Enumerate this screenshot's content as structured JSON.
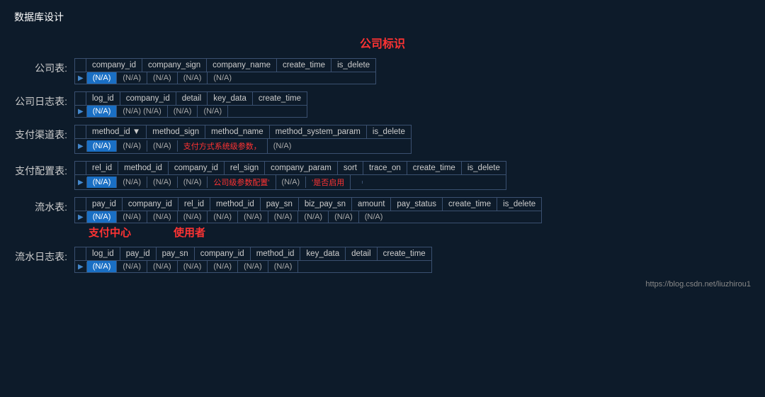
{
  "pageTitle": "数据库设计",
  "centerLabel": "公司标识",
  "footerLink": "https://blog.csdn.net/liuzhirou1",
  "tables": [
    {
      "label": "公司表:",
      "name": "company-table",
      "headers": [
        "company_id",
        "company_sign",
        "company_name",
        "create_time",
        "is_delete"
      ],
      "rows": [
        {
          "cells": [
            "(N/A)",
            "(N/A)",
            "(N/A)",
            "(N/A)",
            "(N/A)"
          ],
          "highlighted": [
            0
          ],
          "redText": []
        }
      ]
    },
    {
      "label": "公司日志表:",
      "name": "company-log-table",
      "headers": [
        "log_id",
        "company_id",
        "detail",
        "key_data",
        "create_time"
      ],
      "rows": [
        {
          "cells": [
            "(N/A)",
            "(N/A)  (N/A)",
            "(N/A)",
            "(N/A)",
            ""
          ],
          "highlighted": [
            0
          ],
          "redText": []
        }
      ]
    },
    {
      "label": "支付渠道表:",
      "name": "payment-channel-table",
      "headers": [
        "method_id ▼",
        "method_sign",
        "method_name",
        "method_system_param",
        "is_delete"
      ],
      "rows": [
        {
          "cells": [
            "(N/A)",
            "(N/A)",
            "(N/A)",
            "支付方式系统级参数，",
            "(N/A)"
          ],
          "highlighted": [
            0
          ],
          "redText": [
            3
          ]
        }
      ]
    },
    {
      "label": "支付配置表:",
      "name": "payment-config-table",
      "headers": [
        "rel_id",
        "method_id",
        "company_id",
        "rel_sign",
        "company_param",
        "sort",
        "trace_on",
        "create_time",
        "is_delete"
      ],
      "rows": [
        {
          "cells": [
            "(N/A)",
            "(N/A)",
            "(N/A)",
            "(N/A)",
            "公司级参数配置'",
            "(N/A)",
            "'是否启用",
            "",
            ""
          ],
          "highlighted": [
            0
          ],
          "redText": [
            4,
            6
          ]
        }
      ]
    },
    {
      "label": "流水表:",
      "name": "flow-table",
      "headers": [
        "pay_id",
        "company_id",
        "rel_id",
        "method_id",
        "pay_sn",
        "biz_pay_sn",
        "amount",
        "pay_status",
        "create_time",
        "is_delete"
      ],
      "rows": [
        {
          "cells": [
            "(N/A)",
            "(N/A)",
            "(N/A)",
            "(N/A)",
            "(N/A)",
            "(N/A)",
            "(N/A)",
            "(N/A)",
            "(N/A)",
            "(N/A)"
          ],
          "highlighted": [
            0
          ],
          "redText": []
        }
      ],
      "annotations": [
        "支付中心",
        "使用者"
      ]
    },
    {
      "label": "流水日志表:",
      "name": "flow-log-table",
      "headers": [
        "log_id",
        "pay_id",
        "pay_sn",
        "company_id",
        "method_id",
        "key_data",
        "detail",
        "create_time"
      ],
      "rows": [
        {
          "cells": [
            "(N/A)",
            "(N/A)",
            "(N/A)",
            "(N/A)",
            "(N/A)",
            "(N/A)",
            "(N/A)",
            ""
          ],
          "highlighted": [
            0
          ],
          "redText": []
        }
      ]
    }
  ]
}
